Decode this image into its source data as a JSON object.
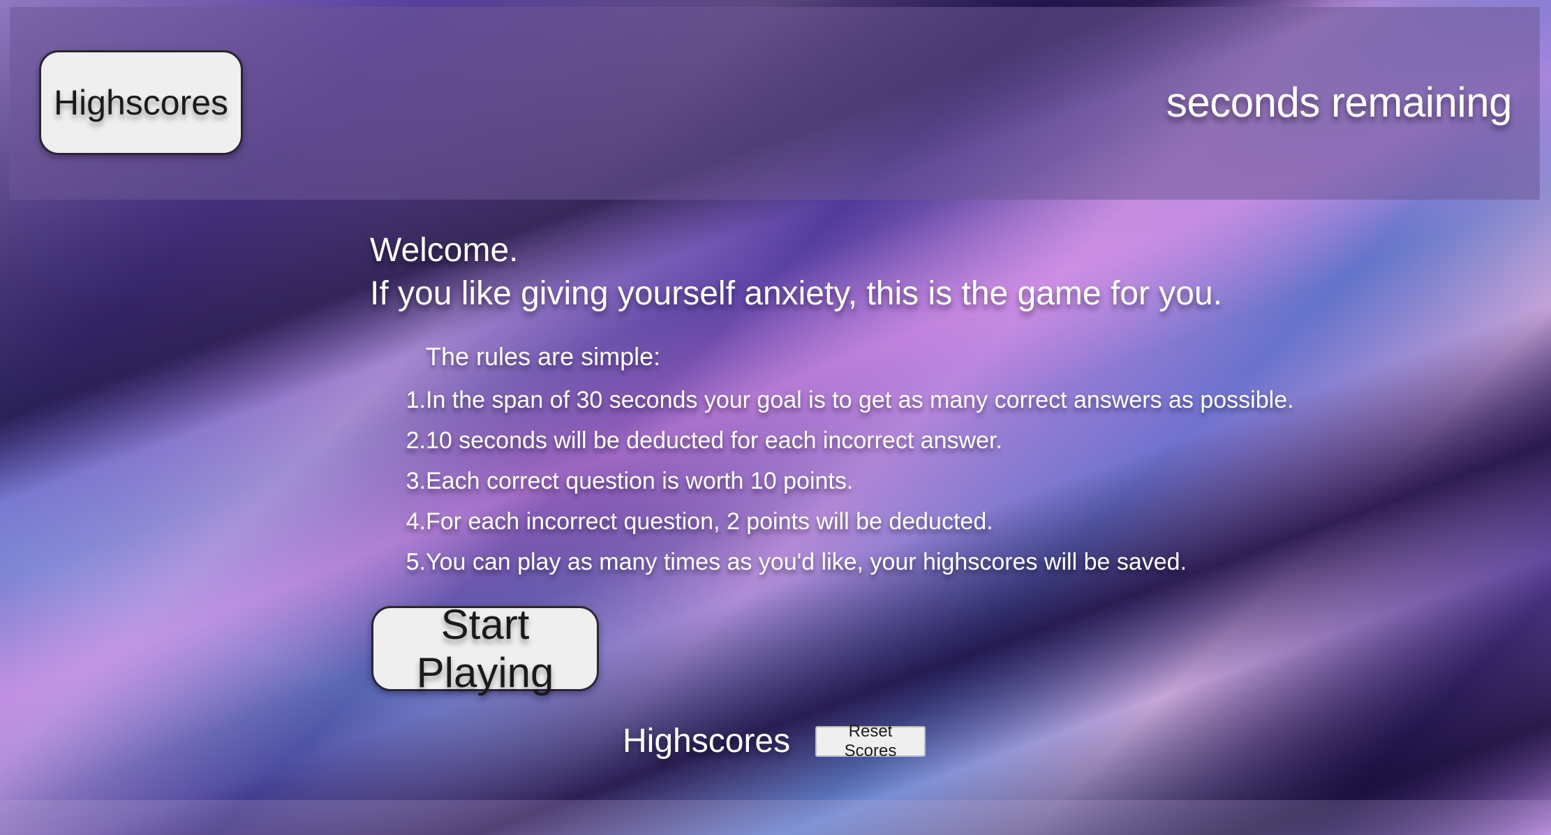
{
  "header": {
    "highscores_button_label": "Highscores",
    "timer_value": "",
    "timer_label": "seconds remaining"
  },
  "intro": {
    "welcome_line": "Welcome.",
    "tagline": "If you like giving yourself anxiety, this is the game for you."
  },
  "rules": {
    "intro": "The rules are simple:",
    "items": [
      {
        "index": "1.",
        "text": "In the span of 30 seconds your goal is to get as many correct answers as possible."
      },
      {
        "index": "2.",
        "text": "10 seconds will be deducted for each incorrect answer."
      },
      {
        "index": "3.",
        "text": "Each correct question is worth 10 points."
      },
      {
        "index": "4.",
        "text": "For each incorrect question, 2 points will be deducted."
      },
      {
        "index": "5.",
        "text": "You can play as many times as you'd like, your highscores will be saved."
      }
    ]
  },
  "actions": {
    "start_label": "Start Playing"
  },
  "highscores": {
    "heading": "Highscores",
    "reset_label": "Reset Scores"
  }
}
